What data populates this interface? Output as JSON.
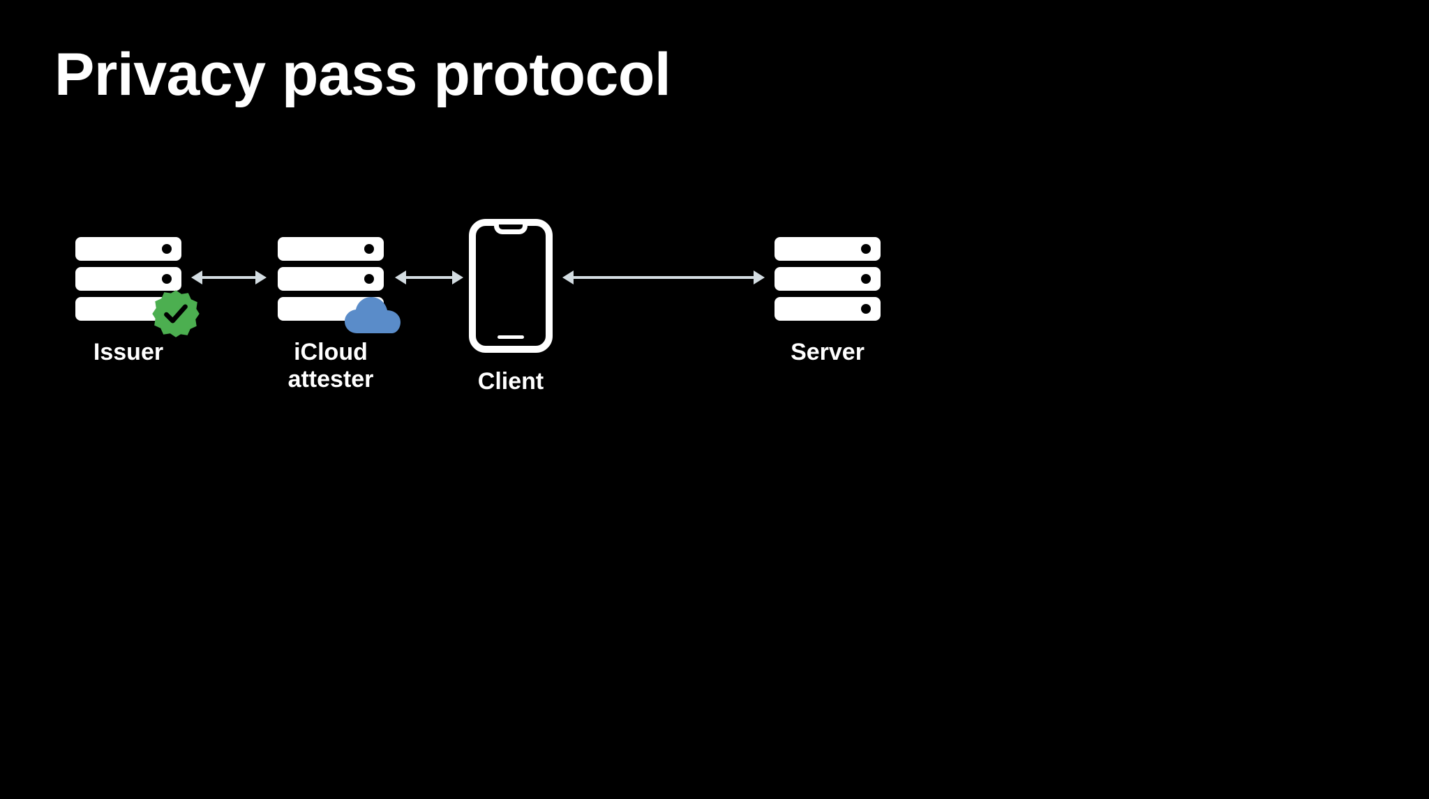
{
  "title": "Privacy pass protocol",
  "nodes": {
    "issuer": {
      "label": "Issuer",
      "icon": "server-with-check-badge-icon"
    },
    "attester": {
      "label": "iCloud attester",
      "icon": "server-with-cloud-icon"
    },
    "client": {
      "label": "Client",
      "icon": "phone-icon"
    },
    "server": {
      "label": "Server",
      "icon": "server-icon"
    }
  },
  "arrows": [
    {
      "from": "issuer",
      "to": "attester",
      "bidirectional": true
    },
    {
      "from": "attester",
      "to": "client",
      "bidirectional": true
    },
    {
      "from": "client",
      "to": "server",
      "bidirectional": true
    }
  ],
  "colors": {
    "background": "#000000",
    "foreground": "#FFFFFF",
    "arrow": "#D4DDE2",
    "badge": "#4CAF50",
    "cloud": "#5A8CC9"
  }
}
